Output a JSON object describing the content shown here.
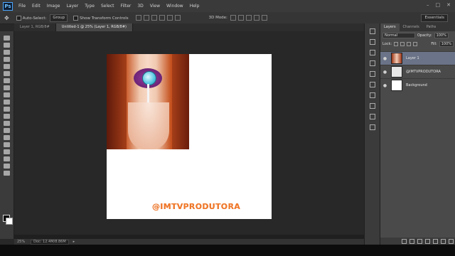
{
  "app": {
    "logo": "Ps"
  },
  "menu": [
    "File",
    "Edit",
    "Image",
    "Layer",
    "Type",
    "Select",
    "Filter",
    "3D",
    "View",
    "Window",
    "Help"
  ],
  "window_controls": {
    "minimize": "–",
    "maximize": "□",
    "close": "✕"
  },
  "options_bar": {
    "auto_select_label": "Auto-Select:",
    "auto_select_value": "Group",
    "transform_label": "Show Transform Controls",
    "mode_label": "3D Mode:",
    "workspace": "Essentials"
  },
  "tabs": [
    {
      "label": "Layer 1, RGB/8#",
      "active": false
    },
    {
      "label": "Untitled-1 @ 25% (Layer 1, RGB/8#)",
      "active": true
    }
  ],
  "canvas": {
    "watermark_text": "@IMTVPRODUTORA",
    "accent": "#f07a2a"
  },
  "status": {
    "zoom": "25%",
    "doc_info": "Doc: 12.4M/8.86M"
  },
  "layers_panel": {
    "tabs": [
      "Layers",
      "Channels",
      "Paths"
    ],
    "blend_mode": "Normal",
    "opacity_label": "Opacity:",
    "opacity_value": "100%",
    "lock_label": "Lock:",
    "fill_label": "Fill:",
    "fill_value": "100%",
    "layers": [
      {
        "name": "Layer 1",
        "selected": true,
        "thumb": "photo"
      },
      {
        "name": "@IMTVPRODUTORA",
        "selected": false,
        "thumb": "text"
      },
      {
        "name": "Background",
        "selected": false,
        "thumb": "white"
      }
    ]
  }
}
